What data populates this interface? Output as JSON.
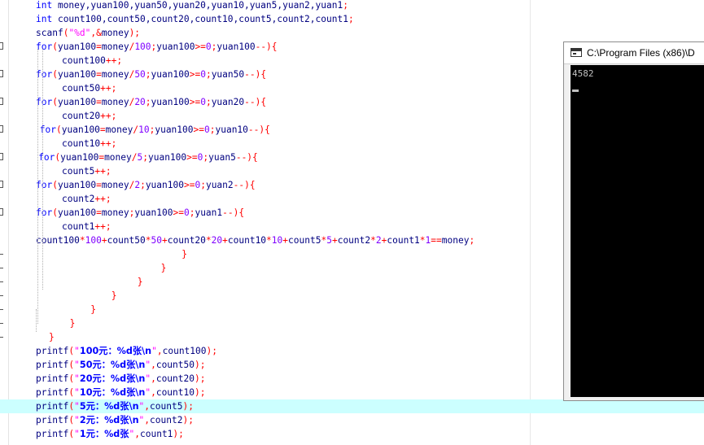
{
  "editor": {
    "lines": [
      {
        "indent": 1,
        "tokens": [
          [
            "kw",
            "int"
          ],
          [
            "id",
            " money,yuan100,yuan50,yuan20,yuan10,yuan5,yuan2,yuan1"
          ],
          [
            "op",
            ";"
          ]
        ]
      },
      {
        "indent": 1,
        "tokens": [
          [
            "kw",
            "int"
          ],
          [
            "id",
            " count100,count50,count20,count10,count5,count2,count1"
          ],
          [
            "op",
            ";"
          ]
        ]
      },
      {
        "indent": 1,
        "tokens": [
          [
            "id",
            "scanf"
          ],
          [
            "op",
            "("
          ],
          [
            "str",
            "\"%d\""
          ],
          [
            "op",
            ",&"
          ],
          [
            "id",
            "money"
          ],
          [
            "op",
            ");"
          ]
        ]
      },
      {
        "indent": 1,
        "marker": true,
        "tokens": [
          [
            "kw",
            "for"
          ],
          [
            "op",
            "("
          ],
          [
            "id",
            "yuan100"
          ],
          [
            "op",
            "="
          ],
          [
            "id",
            "money"
          ],
          [
            "op",
            "/"
          ],
          [
            "num",
            "100"
          ],
          [
            "op",
            ";"
          ],
          [
            "id",
            "yuan100"
          ],
          [
            "op",
            ">="
          ],
          [
            "num",
            "0"
          ],
          [
            "op",
            ";"
          ],
          [
            "id",
            "yuan100"
          ],
          [
            "op",
            "--){"
          ]
        ]
      },
      {
        "indent": 2,
        "tokens": [
          [
            "id",
            "count100"
          ],
          [
            "op",
            "++;"
          ]
        ]
      },
      {
        "indent": 1,
        "marker": true,
        "tokens": [
          [
            "kw",
            "for"
          ],
          [
            "op",
            "("
          ],
          [
            "id",
            "yuan100"
          ],
          [
            "op",
            "="
          ],
          [
            "id",
            "money"
          ],
          [
            "op",
            "/"
          ],
          [
            "num",
            "50"
          ],
          [
            "op",
            ";"
          ],
          [
            "id",
            "yuan100"
          ],
          [
            "op",
            ">="
          ],
          [
            "num",
            "0"
          ],
          [
            "op",
            ";"
          ],
          [
            "id",
            "yuan50"
          ],
          [
            "op",
            "--){"
          ]
        ]
      },
      {
        "indent": 2,
        "tokens": [
          [
            "id",
            "count50"
          ],
          [
            "op",
            "++;"
          ]
        ]
      },
      {
        "indent": 1,
        "marker": true,
        "tokens": [
          [
            "kw",
            "for"
          ],
          [
            "op",
            "("
          ],
          [
            "id",
            "yuan100"
          ],
          [
            "op",
            "="
          ],
          [
            "id",
            "money"
          ],
          [
            "op",
            "/"
          ],
          [
            "num",
            "20"
          ],
          [
            "op",
            ";"
          ],
          [
            "id",
            "yuan100"
          ],
          [
            "op",
            ">="
          ],
          [
            "num",
            "0"
          ],
          [
            "op",
            ";"
          ],
          [
            "id",
            "yuan20"
          ],
          [
            "op",
            "--){"
          ]
        ]
      },
      {
        "indent": 2,
        "tokens": [
          [
            "id",
            "count20"
          ],
          [
            "op",
            "++;"
          ]
        ]
      },
      {
        "indent": 1.15,
        "marker": true,
        "tokens": [
          [
            "kw",
            "for"
          ],
          [
            "op",
            "("
          ],
          [
            "id",
            "yuan100"
          ],
          [
            "op",
            "="
          ],
          [
            "id",
            "money"
          ],
          [
            "op",
            "/"
          ],
          [
            "num",
            "10"
          ],
          [
            "op",
            ";"
          ],
          [
            "id",
            "yuan100"
          ],
          [
            "op",
            ">="
          ],
          [
            "num",
            "0"
          ],
          [
            "op",
            ";"
          ],
          [
            "id",
            "yuan10"
          ],
          [
            "op",
            "--){"
          ]
        ]
      },
      {
        "indent": 2,
        "tokens": [
          [
            "id",
            "count10"
          ],
          [
            "op",
            "++;"
          ]
        ]
      },
      {
        "indent": 1.1,
        "marker": true,
        "tokens": [
          [
            "kw",
            "for"
          ],
          [
            "op",
            "("
          ],
          [
            "id",
            "yuan100"
          ],
          [
            "op",
            "="
          ],
          [
            "id",
            "money"
          ],
          [
            "op",
            "/"
          ],
          [
            "num",
            "5"
          ],
          [
            "op",
            ";"
          ],
          [
            "id",
            "yuan100"
          ],
          [
            "op",
            ">="
          ],
          [
            "num",
            "0"
          ],
          [
            "op",
            ";"
          ],
          [
            "id",
            "yuan5"
          ],
          [
            "op",
            "--){"
          ]
        ]
      },
      {
        "indent": 2,
        "tokens": [
          [
            "id",
            "count5"
          ],
          [
            "op",
            "++;"
          ]
        ]
      },
      {
        "indent": 1,
        "marker": true,
        "tokens": [
          [
            "kw",
            "for"
          ],
          [
            "op",
            "("
          ],
          [
            "id",
            "yuan100"
          ],
          [
            "op",
            "="
          ],
          [
            "id",
            "money"
          ],
          [
            "op",
            "/"
          ],
          [
            "num",
            "2"
          ],
          [
            "op",
            ";"
          ],
          [
            "id",
            "yuan100"
          ],
          [
            "op",
            ">="
          ],
          [
            "num",
            "0"
          ],
          [
            "op",
            ";"
          ],
          [
            "id",
            "yuan2"
          ],
          [
            "op",
            "--){"
          ]
        ]
      },
      {
        "indent": 2,
        "tokens": [
          [
            "id",
            "count2"
          ],
          [
            "op",
            "++;"
          ]
        ]
      },
      {
        "indent": 1,
        "marker": true,
        "tokens": [
          [
            "kw",
            "for"
          ],
          [
            "op",
            "("
          ],
          [
            "id",
            "yuan100"
          ],
          [
            "op",
            "="
          ],
          [
            "id",
            "money"
          ],
          [
            "op",
            ";"
          ],
          [
            "id",
            "yuan100"
          ],
          [
            "op",
            ">="
          ],
          [
            "num",
            "0"
          ],
          [
            "op",
            ";"
          ],
          [
            "id",
            "yuan1"
          ],
          [
            "op",
            "--){"
          ]
        ]
      },
      {
        "indent": 2,
        "tokens": [
          [
            "id",
            "count1"
          ],
          [
            "op",
            "++;"
          ]
        ]
      },
      {
        "indent": 1,
        "tokens": [
          [
            "id",
            "count100"
          ],
          [
            "op",
            "*"
          ],
          [
            "num",
            "100"
          ],
          [
            "op",
            "+"
          ],
          [
            "id",
            "count50"
          ],
          [
            "op",
            "*"
          ],
          [
            "num",
            "50"
          ],
          [
            "op",
            "+"
          ],
          [
            "id",
            "count20"
          ],
          [
            "op",
            "*"
          ],
          [
            "num",
            "20"
          ],
          [
            "op",
            "+"
          ],
          [
            "id",
            "count10"
          ],
          [
            "op",
            "*"
          ],
          [
            "num",
            "10"
          ],
          [
            "op",
            "+"
          ],
          [
            "id",
            "count5"
          ],
          [
            "op",
            "*"
          ],
          [
            "num",
            "5"
          ],
          [
            "op",
            "+"
          ],
          [
            "id",
            "count2"
          ],
          [
            "op",
            "*"
          ],
          [
            "num",
            "2"
          ],
          [
            "op",
            "+"
          ],
          [
            "id",
            "count1"
          ],
          [
            "op",
            "*"
          ],
          [
            "num",
            "1"
          ],
          [
            "op",
            "=="
          ],
          [
            "id",
            "money"
          ],
          [
            "op",
            ";"
          ]
        ]
      },
      {
        "indent": 6.6,
        "dash": true,
        "tokens": [
          [
            "op",
            "}"
          ]
        ]
      },
      {
        "indent": 5.8,
        "dash": true,
        "tokens": [
          [
            "op",
            "}"
          ]
        ]
      },
      {
        "indent": 4.9,
        "dash": true,
        "tokens": [
          [
            "op",
            "}"
          ]
        ]
      },
      {
        "indent": 3.9,
        "dash": true,
        "tokens": [
          [
            "op",
            "}"
          ]
        ]
      },
      {
        "indent": 3.1,
        "dash": true,
        "tokens": [
          [
            "op",
            "}"
          ]
        ]
      },
      {
        "indent": 2.3,
        "dash": true,
        "tokens": [
          [
            "op",
            "}"
          ]
        ]
      },
      {
        "indent": 1.5,
        "dash": true,
        "tokens": [
          [
            "op",
            "}"
          ]
        ]
      },
      {
        "indent": 1,
        "tokens": [
          [
            "id",
            "printf"
          ],
          [
            "op",
            "("
          ],
          [
            "str",
            "\""
          ],
          [
            "cn",
            "100元：%d张\\n"
          ],
          [
            "str",
            "\""
          ],
          [
            "op",
            ","
          ],
          [
            "id",
            "count100"
          ],
          [
            "op",
            ");"
          ]
        ]
      },
      {
        "indent": 1,
        "tokens": [
          [
            "id",
            "printf"
          ],
          [
            "op",
            "("
          ],
          [
            "str",
            "\""
          ],
          [
            "cn",
            "50元：%d张\\n"
          ],
          [
            "str",
            "\""
          ],
          [
            "op",
            ","
          ],
          [
            "id",
            "count50"
          ],
          [
            "op",
            ");"
          ]
        ]
      },
      {
        "indent": 1,
        "tokens": [
          [
            "id",
            "printf"
          ],
          [
            "op",
            "("
          ],
          [
            "str",
            "\""
          ],
          [
            "cn",
            "20元：%d张\\n"
          ],
          [
            "str",
            "\""
          ],
          [
            "op",
            ","
          ],
          [
            "id",
            "count20"
          ],
          [
            "op",
            ");"
          ]
        ]
      },
      {
        "indent": 1,
        "tokens": [
          [
            "id",
            "printf"
          ],
          [
            "op",
            "("
          ],
          [
            "str",
            "\""
          ],
          [
            "cn",
            "10元：%d张\\n"
          ],
          [
            "str",
            "\""
          ],
          [
            "op",
            ","
          ],
          [
            "id",
            "count10"
          ],
          [
            "op",
            ");"
          ]
        ]
      },
      {
        "indent": 1,
        "current": true,
        "tokens": [
          [
            "id",
            "printf"
          ],
          [
            "op",
            "("
          ],
          [
            "str",
            "\""
          ],
          [
            "cn",
            "5元：%d张\\n"
          ],
          [
            "str",
            "\""
          ],
          [
            "op",
            ","
          ],
          [
            "id",
            "count5"
          ],
          [
            "op",
            ");"
          ]
        ]
      },
      {
        "indent": 1,
        "tokens": [
          [
            "id",
            "printf"
          ],
          [
            "op",
            "("
          ],
          [
            "str",
            "\""
          ],
          [
            "cn",
            "2元：%d张\\n"
          ],
          [
            "str",
            "\""
          ],
          [
            "op",
            ","
          ],
          [
            "id",
            "count2"
          ],
          [
            "op",
            ");"
          ]
        ]
      },
      {
        "indent": 1,
        "tokens": [
          [
            "id",
            "printf"
          ],
          [
            "op",
            "("
          ],
          [
            "str",
            "\""
          ],
          [
            "cn",
            "1元：%d张"
          ],
          [
            "str",
            "\""
          ],
          [
            "op",
            ","
          ],
          [
            "id",
            "count1"
          ],
          [
            "op",
            ");"
          ]
        ]
      }
    ]
  },
  "console": {
    "title": "C:\\Program Files (x86)\\D",
    "output": "4582",
    "icon": "console-window-icon"
  },
  "colors": {
    "keyword": "#0000ff",
    "identifier": "#000080",
    "operator": "#ff0000",
    "string": "#ff00ff",
    "number": "#8000ff",
    "current_line": "#ccffff",
    "console_bg": "#000000"
  }
}
